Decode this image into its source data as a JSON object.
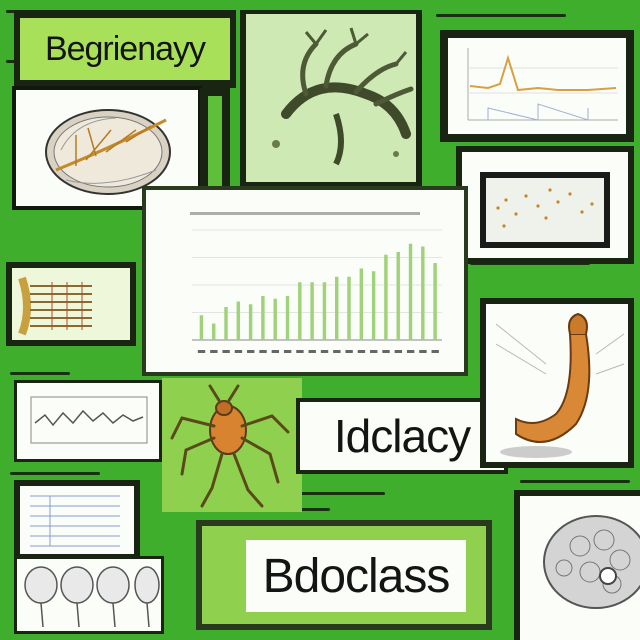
{
  "labels": {
    "top_left": "Begrienayy",
    "middle_right": "Idclacy",
    "bottom_center": "Bdoclass"
  },
  "chart_data": {
    "type": "bar",
    "values": [
      9,
      6,
      12,
      14,
      13,
      16,
      15,
      16,
      21,
      21,
      21,
      23,
      23,
      26,
      25,
      31,
      32,
      35,
      34,
      28
    ]
  },
  "colors": {
    "background": "#3fae2c",
    "light_green": "#8fd14f",
    "lime": "#a8e05a",
    "dark": "#0f1a0c",
    "bar": "#9fd27a"
  }
}
